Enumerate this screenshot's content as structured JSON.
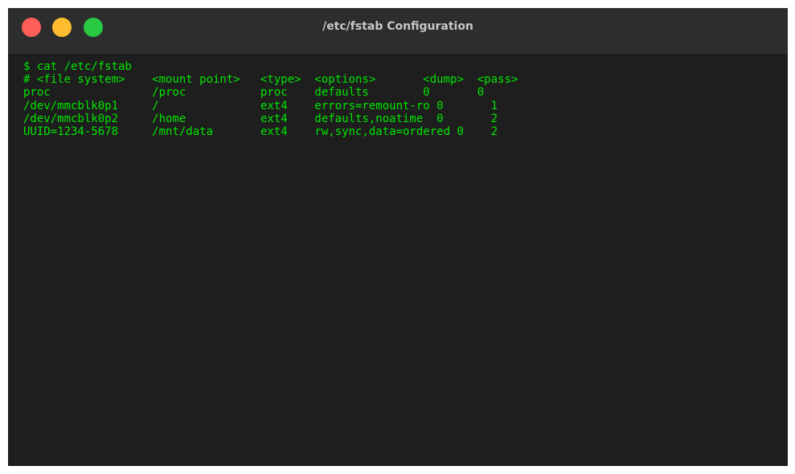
{
  "window": {
    "title": "/etc/fstab Configuration",
    "buttons": {
      "close_color": "#ff5f57",
      "minimize_color": "#febc2e",
      "maximize_color": "#28c840"
    }
  },
  "terminal": {
    "text_color": "#00e600",
    "background_color": "#1e1e1e",
    "lines": [
      "$ cat /etc/fstab",
      "# <file system>    <mount point>   <type>  <options>       <dump>  <pass>",
      "proc               /proc           proc    defaults        0       0",
      "/dev/mmcblk0p1     /               ext4    errors=remount-ro 0       1",
      "/dev/mmcblk0p2     /home           ext4    defaults,noatime  0       2",
      "UUID=1234-5678     /mnt/data       ext4    rw,sync,data=ordered 0    2"
    ]
  }
}
